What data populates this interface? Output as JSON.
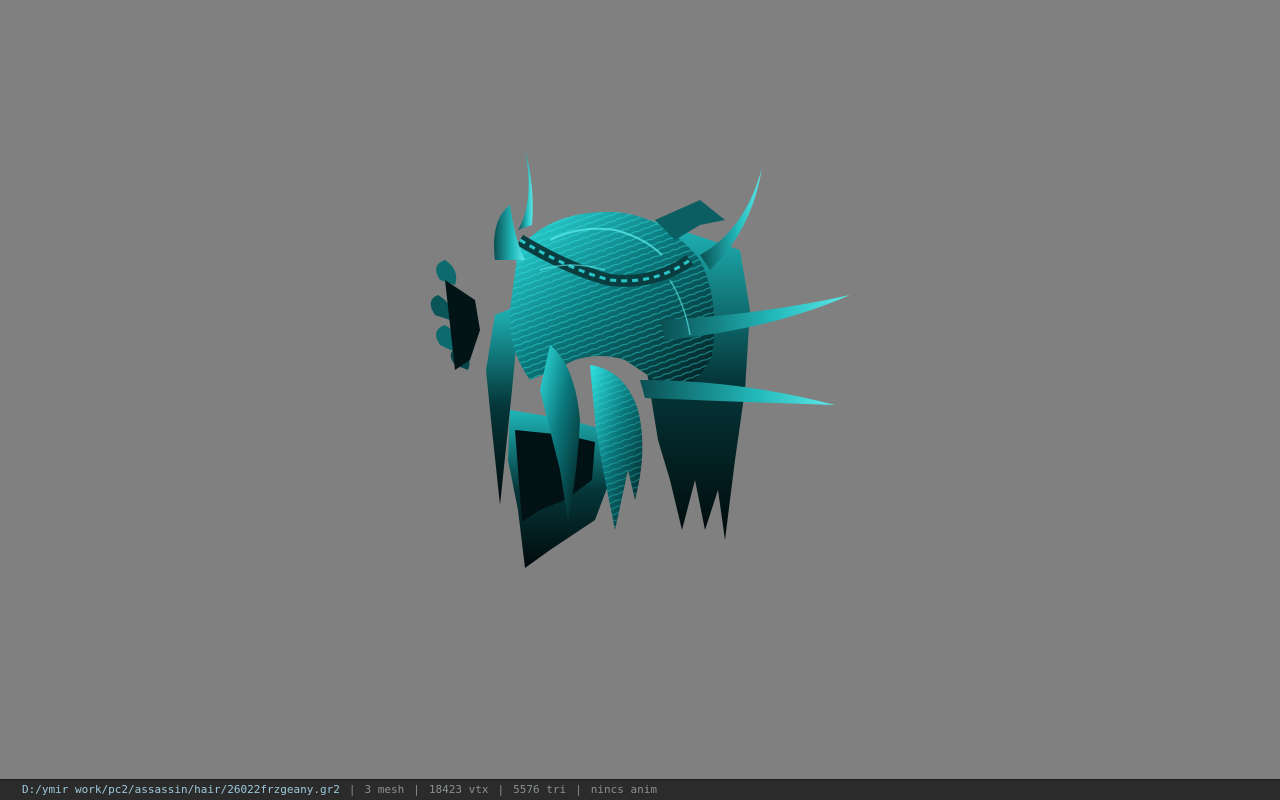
{
  "viewer": {
    "background_color": "#808080",
    "model_tint": "#2fd8d8",
    "model_shadow": "#041214"
  },
  "statusbar": {
    "file_path": "D:/ymir work/pc2/assassin/hair/26022frzgeany.gr2",
    "mesh_count": "3 mesh",
    "vertex_count": "18423 vtx",
    "triangle_count": "5576 tri",
    "animation": "nincs anim",
    "separator": "|"
  }
}
